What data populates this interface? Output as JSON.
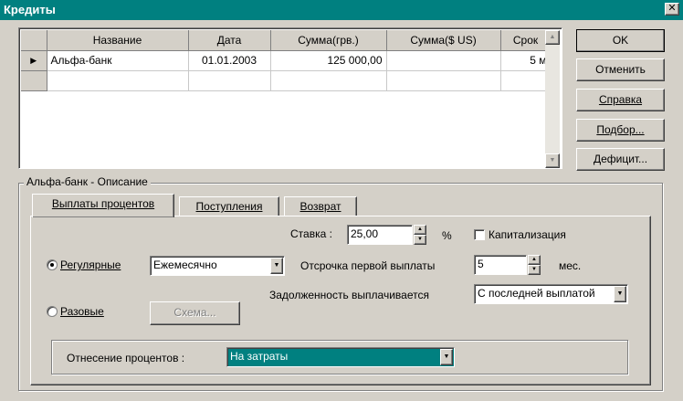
{
  "window": {
    "title": "Кредиты",
    "close_glyph": "✕"
  },
  "grid": {
    "columns": [
      "Название",
      "Дата",
      "Сумма(грв.)",
      "Сумма($ US)",
      "Срок"
    ],
    "rows": [
      {
        "indicator": "▶",
        "name": "Альфа-банк",
        "date": "01.01.2003",
        "sum_uah": "125 000,00",
        "sum_usd": "",
        "term": "5 м"
      }
    ]
  },
  "buttons": {
    "ok": "OK",
    "cancel": "Отменить",
    "help": "Справка",
    "selection": "Подбор...",
    "deficit": "Дефицит..."
  },
  "group": {
    "label": "Альфа-банк - Описание"
  },
  "tabs": [
    "Выплаты процентов",
    "Поступления",
    "Возврат"
  ],
  "interest": {
    "rate_label": "Ставка :",
    "rate_value": "25,00",
    "rate_unit": "%",
    "capitalization_label": "Капитализация",
    "capitalization_checked": false,
    "regular_label": "Регулярные",
    "regular_selected": true,
    "periodicity_value": "Ежемесячно",
    "delay_label": "Отсрочка первой выплаты",
    "delay_value": "5",
    "delay_unit": "мес.",
    "debt_label": "Задолженность выплачивается",
    "debt_value": "С последней выплатой",
    "onetime_label": "Разовые",
    "onetime_selected": false,
    "schema_button": "Схема...",
    "attribution_label": "Отнесение процентов :",
    "attribution_value": "На затраты"
  },
  "colors": {
    "titlebar": "#008080",
    "face": "#d4d0c8",
    "highlight": "#008080"
  }
}
